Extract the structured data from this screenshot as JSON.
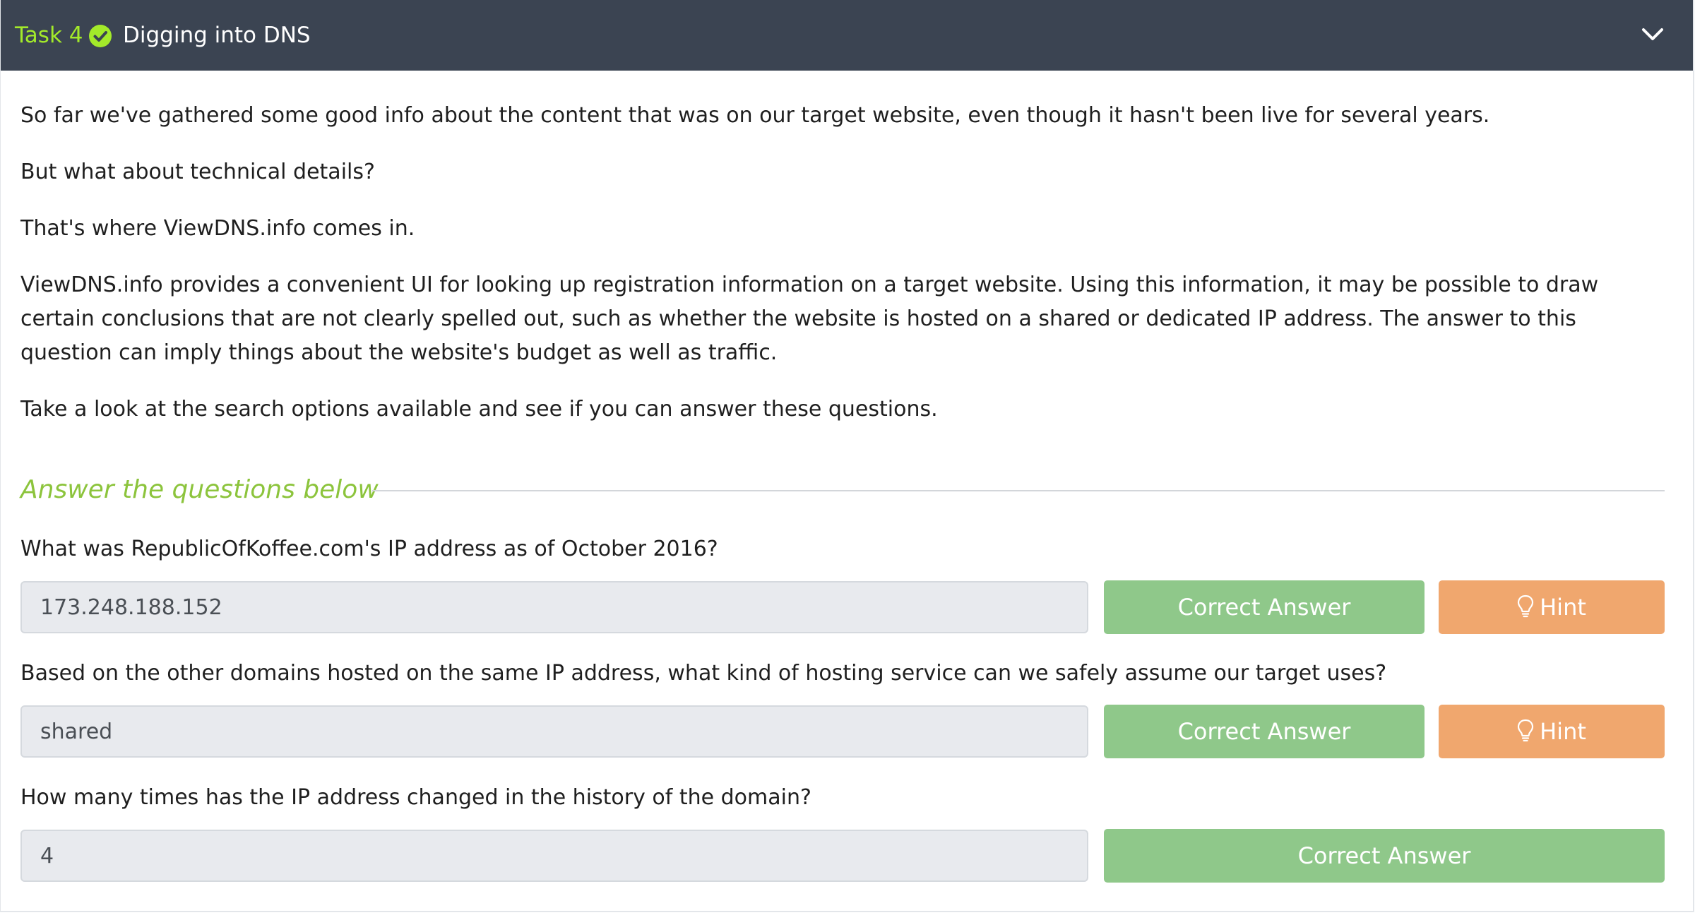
{
  "header": {
    "task_label": "Task 4",
    "title": "Digging into DNS",
    "completed_icon": "check-circle-icon",
    "collapse_icon": "chevron-down-icon",
    "task_color": "#a3ea2a",
    "background": "#3b4452"
  },
  "content": {
    "paragraphs": [
      "So far we've gathered some good info about the content that was on our target website, even though it hasn't been live for several years.",
      "But what about technical details?",
      "That's where ViewDNS.info comes in.",
      "ViewDNS.info provides a convenient UI for looking up registration information on a target website. Using this information, it may be possible to draw certain conclusions that are not clearly spelled out, such as whether the website is hosted on a shared or dedicated IP address. The answer to this question can imply things about the website's budget as well as traffic.",
      "Take a look at the search options available and see if you can answer these questions."
    ]
  },
  "questions_section": {
    "title": "Answer the questions below",
    "questions": [
      {
        "text": "What was RepublicOfKoffee.com's IP address as of October 2016?",
        "answer": "173.248.188.152",
        "submit_label": "Correct Answer",
        "hint_label": "Hint"
      },
      {
        "text": "Based on the other domains hosted on the same IP address, what kind of hosting service can we safely assume our target uses?",
        "answer": "shared",
        "submit_label": "Correct Answer",
        "hint_label": "Hint"
      },
      {
        "text": "How many times has the IP address changed in the history of the domain?",
        "answer": "4",
        "submit_label": "Correct Answer"
      }
    ]
  },
  "colors": {
    "correct_button": "#8fc88a",
    "hint_button": "#f0a76e",
    "section_title": "#8cc43c"
  }
}
